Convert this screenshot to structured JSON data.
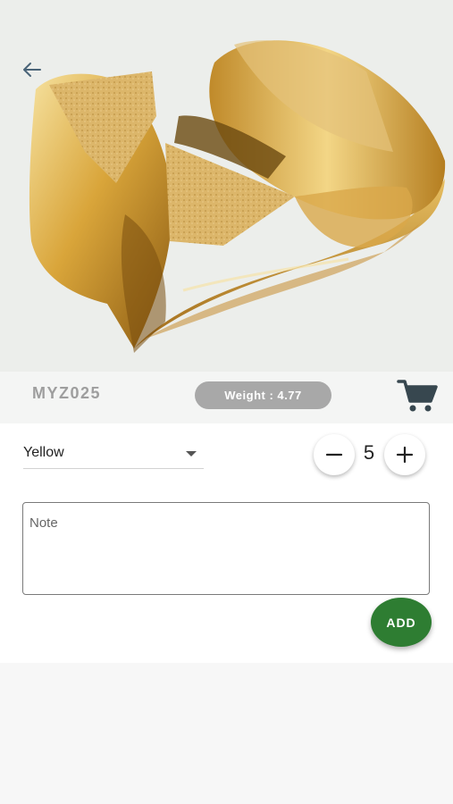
{
  "product": {
    "code": "MYZ025",
    "weight_label": "Weight : 4.77",
    "image_icon": "gold-ring-photo"
  },
  "navigation": {
    "back_icon": "arrow-left-icon"
  },
  "cart": {
    "icon": "shopping-cart-icon"
  },
  "options": {
    "color": {
      "selected": "Yellow"
    },
    "quantity": {
      "value": "5",
      "decrement_icon": "minus-icon",
      "increment_icon": "plus-icon"
    }
  },
  "note": {
    "placeholder": "Note",
    "value": ""
  },
  "actions": {
    "add_label": "ADD"
  },
  "colors": {
    "accent_green": "#2e7d32",
    "weight_pill": "#a8a8a8",
    "sku_text": "#9e9e9e",
    "cart_icon": "#37474f"
  }
}
